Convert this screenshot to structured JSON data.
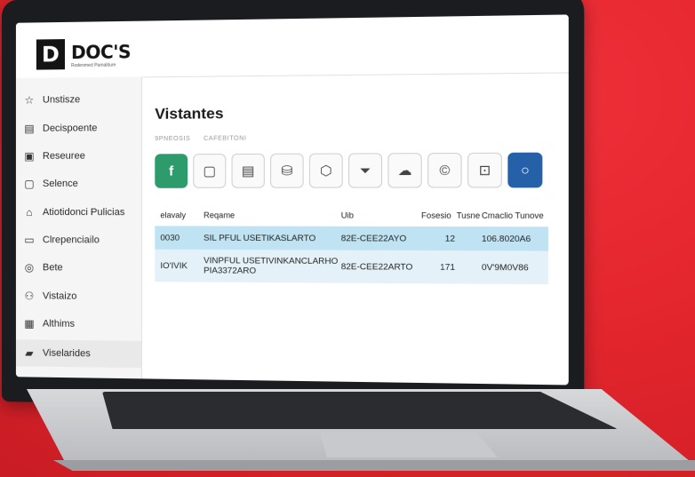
{
  "brand": {
    "logo_letter": "D",
    "name": "DOC'S",
    "tagline": "Rodenmed Pamaliture"
  },
  "sidebar": {
    "items": [
      {
        "label": "Unstisze",
        "icon": "star-icon"
      },
      {
        "label": "Decispoente",
        "icon": "document-icon"
      },
      {
        "label": "Reseuree",
        "icon": "image-icon"
      },
      {
        "label": "Selence",
        "icon": "square-icon"
      },
      {
        "label": "Atiotidonci Pulicias",
        "icon": "home-icon"
      },
      {
        "label": "Clrepenciailo",
        "icon": "card-icon"
      },
      {
        "label": "Bete",
        "icon": "target-icon"
      },
      {
        "label": "Vistaizo",
        "icon": "user-icon"
      },
      {
        "label": "Althims",
        "icon": "building-icon"
      },
      {
        "label": "Viselarides",
        "icon": "folder-icon",
        "active": true
      }
    ]
  },
  "main": {
    "title": "Vistantes",
    "sub_labels": [
      "9PNEOSIS",
      "CAFEBITONI"
    ],
    "toolbar": [
      {
        "icon": "facebook-icon",
        "glyph": "f"
      },
      {
        "icon": "square-outline-icon",
        "glyph": "▢"
      },
      {
        "icon": "document-icon",
        "glyph": "▤"
      },
      {
        "icon": "cylinder-icon",
        "glyph": "⛁"
      },
      {
        "icon": "shield-icon",
        "glyph": "⬡"
      },
      {
        "icon": "filter-icon",
        "glyph": "⏷"
      },
      {
        "icon": "cloud-icon",
        "glyph": "☁"
      },
      {
        "icon": "copyright-icon",
        "glyph": "©"
      },
      {
        "icon": "lock-icon",
        "glyph": "⊡"
      },
      {
        "icon": "circle-icon",
        "glyph": "○"
      }
    ],
    "table": {
      "headers": [
        "elavaly",
        "Reqame",
        "Uib",
        "Fosesio",
        "Tusne",
        "Cmaclio Tunove"
      ],
      "rows": [
        [
          "0030",
          "SIL PFUL USETIKASLARTO",
          "82E-CEE22AYO",
          "12",
          "",
          "106.8020A6"
        ],
        [
          "IO'IVIK",
          "VINPFUL USETIVINKANCLARHO PIA3372ARO",
          "82E-CEE22ARTO",
          "171",
          "",
          "0V'9M0V86"
        ]
      ]
    }
  },
  "colors": {
    "background": "#e3252d",
    "accent_green": "#2e9b6c",
    "accent_blue": "#2560a8",
    "row_highlight": "#bfe3f2"
  }
}
